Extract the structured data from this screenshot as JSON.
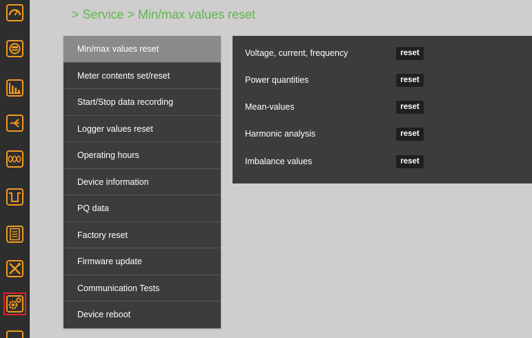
{
  "breadcrumb": {
    "text": "> Service > Min/max values reset"
  },
  "rail": {
    "accent_color": "#f29a1f",
    "active_outline_color": "#e3202b",
    "icons": [
      {
        "name": "gauge-icon"
      },
      {
        "name": "meter-icon"
      },
      {
        "name": "bar-chart-icon"
      },
      {
        "name": "phasor-icon"
      },
      {
        "name": "waveform-icon"
      },
      {
        "name": "transient-icon"
      },
      {
        "name": "list-icon"
      },
      {
        "name": "tools-icon"
      },
      {
        "name": "settings-gear-icon"
      }
    ]
  },
  "menu": {
    "items": [
      {
        "label": "Min/max values reset",
        "selected": true
      },
      {
        "label": "Meter contents set/reset"
      },
      {
        "label": "Start/Stop data recording"
      },
      {
        "label": "Logger values reset"
      },
      {
        "label": "Operating hours"
      },
      {
        "label": "Device information"
      },
      {
        "label": "PQ data"
      },
      {
        "label": "Factory reset"
      },
      {
        "label": "Firmware update"
      },
      {
        "label": "Communication Tests"
      },
      {
        "label": "Device reboot"
      }
    ]
  },
  "panel": {
    "rows": [
      {
        "label": "Voltage, current, frequency",
        "button": "reset"
      },
      {
        "label": "Power quantities",
        "button": "reset"
      },
      {
        "label": "Mean-values",
        "button": "reset"
      },
      {
        "label": "Harmonic analysis",
        "button": "reset"
      },
      {
        "label": "Imbalance values",
        "button": "reset"
      }
    ]
  }
}
